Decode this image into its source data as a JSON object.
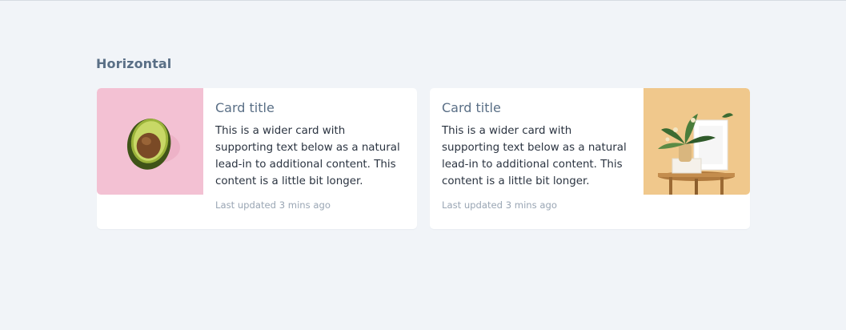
{
  "section": {
    "title": "Horizontal"
  },
  "cards": [
    {
      "image": "avocado-photo",
      "image_bg": "#f3c1d3",
      "title": "Card title",
      "text": "This is a wider card with supporting text below as a natural lead-in to additional content. This content is a little bit longer.",
      "meta": "Last updated 3 mins ago"
    },
    {
      "image": "plant-and-frame-photo",
      "image_bg": "#f0c88c",
      "title": "Card title",
      "text": "This is a wider card with supporting text below as a natural lead-in to additional content. This content is a little bit longer.",
      "meta": "Last updated 3 mins ago"
    }
  ]
}
